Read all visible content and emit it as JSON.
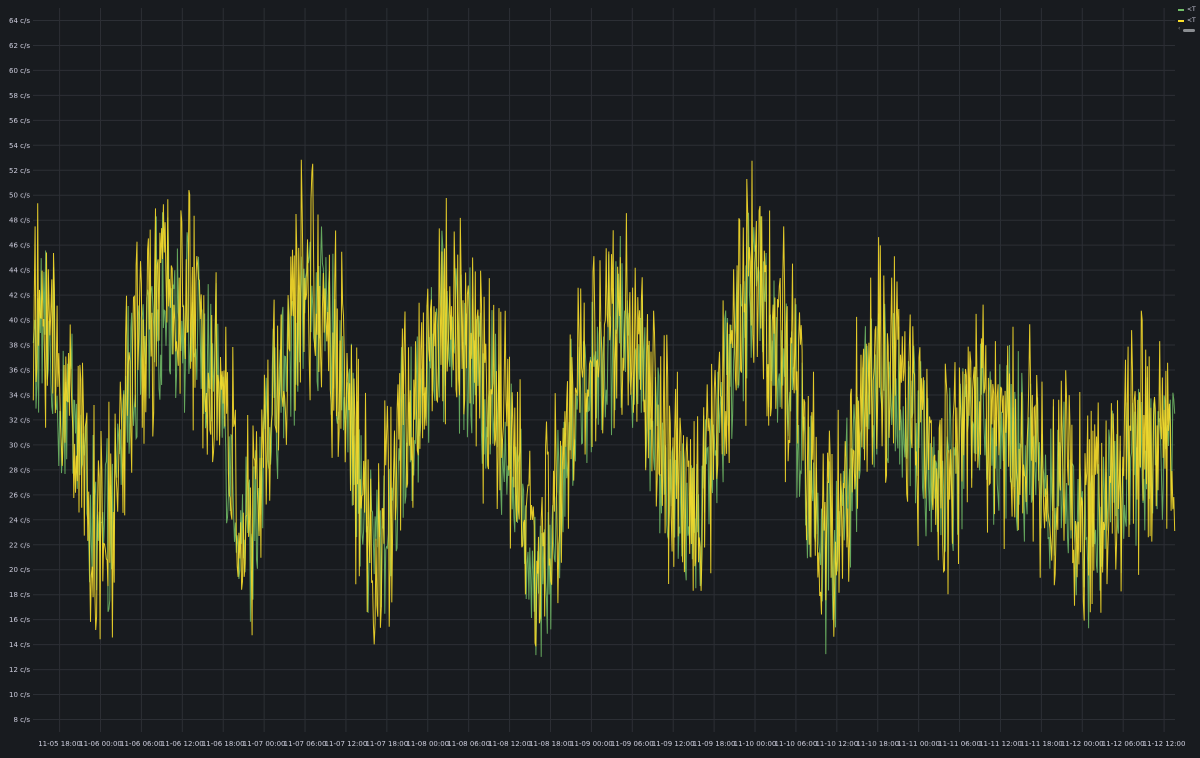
{
  "chart_data": {
    "type": "line",
    "ylim": [
      7,
      65
    ],
    "y_tick_labels": [
      "8 c/s",
      "10 c/s",
      "12 c/s",
      "14 c/s",
      "16 c/s",
      "18 c/s",
      "20 c/s",
      "22 c/s",
      "24 c/s",
      "26 c/s",
      "28 c/s",
      "30 c/s",
      "32 c/s",
      "34 c/s",
      "36 c/s",
      "38 c/s",
      "40 c/s",
      "42 c/s",
      "44 c/s",
      "46 c/s",
      "48 c/s",
      "50 c/s",
      "52 c/s",
      "54 c/s",
      "56 c/s",
      "58 c/s",
      "60 c/s",
      "62 c/s",
      "64 c/s"
    ],
    "y_tick_values": [
      8,
      10,
      12,
      14,
      16,
      18,
      20,
      22,
      24,
      26,
      28,
      30,
      32,
      34,
      36,
      38,
      40,
      42,
      44,
      46,
      48,
      50,
      52,
      54,
      56,
      58,
      60,
      62,
      64
    ],
    "x_tick_labels": [
      "11-05 18:00",
      "11-06 00:00",
      "11-06 06:00",
      "11-06 12:00",
      "11-06 18:00",
      "11-07 00:00",
      "11-07 06:00",
      "11-07 12:00",
      "11-07 18:00",
      "11-08 00:00",
      "11-08 06:00",
      "11-08 12:00",
      "11-08 18:00",
      "11-09 00:00",
      "11-09 06:00",
      "11-09 12:00",
      "11-09 18:00",
      "11-10 00:00",
      "11-10 06:00",
      "11-10 12:00",
      "11-10 18:00",
      "11-11 00:00",
      "11-11 06:00",
      "11-11 12:00",
      "11-11 18:00",
      "11-12 00:00",
      "11-12 06:00",
      "11-12 12:00"
    ],
    "x_tick_hours": [
      18,
      24,
      30,
      36,
      42,
      48,
      54,
      60,
      66,
      72,
      78,
      84,
      90,
      96,
      102,
      108,
      114,
      120,
      126,
      132,
      138,
      144,
      150,
      156,
      162,
      168,
      174,
      180
    ],
    "xlim_hours": [
      14.1,
      181.6
    ],
    "grid": true,
    "legend_placement": "top-right",
    "series": [
      {
        "color": "#73bf69",
        "key_hours": [
          14.2,
          16,
          18,
          20,
          22,
          24,
          26,
          28,
          30,
          32,
          34,
          36,
          38,
          40,
          42,
          44,
          46,
          48,
          50,
          52,
          54,
          56,
          58,
          60,
          62,
          64,
          66,
          68,
          70,
          72,
          74,
          76,
          78,
          80,
          82,
          84,
          86,
          88,
          90,
          92,
          94,
          96,
          98,
          100,
          102,
          104,
          106,
          108,
          110,
          112,
          114,
          116,
          118,
          120,
          122,
          124,
          126,
          128,
          130,
          132,
          134,
          136,
          138,
          140,
          142,
          144,
          146,
          148,
          150,
          152,
          154,
          156,
          158,
          160,
          162,
          164,
          166,
          168,
          170,
          172,
          174,
          176,
          178,
          180,
          181.5
        ],
        "key_values": [
          37,
          40,
          33,
          34,
          26,
          21,
          24,
          35,
          37,
          40,
          42,
          41,
          38,
          36,
          33,
          25,
          22,
          28,
          34,
          38,
          43,
          41,
          38,
          35,
          26,
          22,
          23,
          30,
          31,
          37,
          39,
          40,
          37,
          35,
          33,
          30,
          24,
          20,
          22,
          28,
          34,
          36,
          38,
          40,
          37,
          35,
          30,
          25,
          24,
          26,
          30,
          36,
          40,
          43,
          40,
          37,
          34,
          26,
          21,
          22,
          28,
          33,
          35,
          34,
          33,
          30,
          28,
          27,
          30,
          34,
          31,
          30,
          30,
          29,
          28,
          27,
          26,
          23,
          24,
          26,
          28,
          29,
          30,
          30,
          30
        ],
        "amplitude": 6
      },
      {
        "color": "#fade2a",
        "key_hours": [
          14.2,
          16,
          18,
          20,
          22,
          24,
          26,
          28,
          30,
          32,
          34,
          36,
          38,
          40,
          42,
          44,
          46,
          48,
          50,
          52,
          54,
          56,
          58,
          60,
          62,
          64,
          66,
          68,
          70,
          72,
          74,
          76,
          78,
          80,
          82,
          84,
          86,
          88,
          90,
          92,
          94,
          96,
          98,
          100,
          102,
          104,
          106,
          108,
          110,
          112,
          114,
          116,
          118,
          120,
          122,
          124,
          126,
          128,
          130,
          132,
          134,
          136,
          138,
          140,
          142,
          144,
          146,
          148,
          150,
          152,
          154,
          156,
          158,
          160,
          162,
          164,
          166,
          168,
          170,
          172,
          174,
          176,
          178,
          180,
          181.5
        ],
        "key_values": [
          38,
          42,
          34,
          34,
          27,
          21,
          24,
          36,
          38,
          41,
          43,
          42,
          39,
          37,
          34,
          26,
          22,
          29,
          35,
          39,
          44,
          42,
          39,
          36,
          27,
          22,
          24,
          31,
          32,
          38,
          40,
          41,
          38,
          36,
          34,
          31,
          25,
          21,
          23,
          29,
          35,
          37,
          39,
          41,
          38,
          36,
          31,
          26,
          25,
          27,
          31,
          37,
          41,
          45,
          41,
          38,
          35,
          27,
          22,
          23,
          29,
          34,
          36,
          35,
          34,
          31,
          29,
          28,
          31,
          35,
          32,
          31,
          31,
          30,
          29,
          28,
          27,
          24,
          25,
          27,
          29,
          30,
          31,
          31,
          31
        ],
        "amplitude": 8
      }
    ]
  }
}
